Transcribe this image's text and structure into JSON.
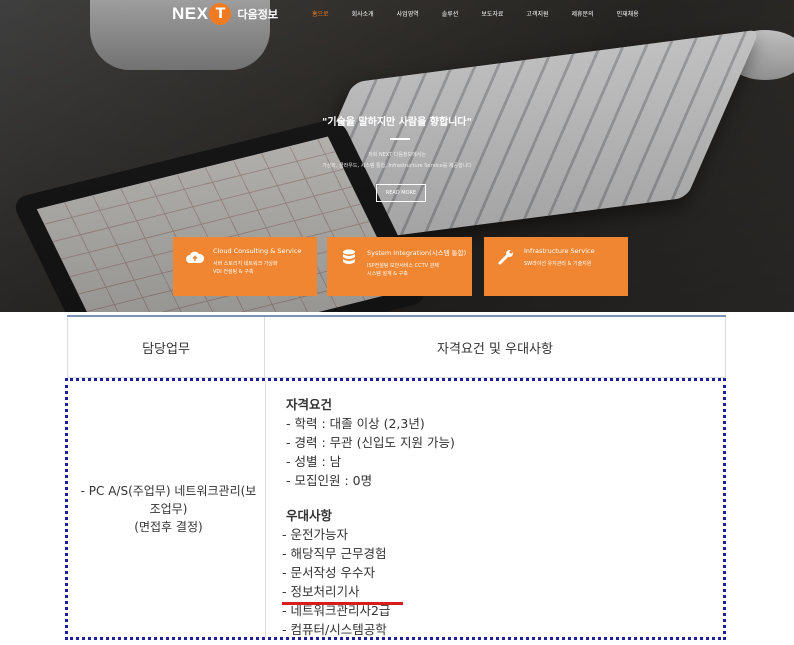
{
  "nav": {
    "logo_en": "NEX",
    "logo_circle": "T",
    "logo_ko": "다음정보",
    "menu": [
      "홈으로",
      "회사소개",
      "사업영역",
      "솔루션",
      "보도자료",
      "고객지원",
      "제휴문의",
      "인재채용"
    ]
  },
  "hero": {
    "tagline": "\"기술을 말하지만 사람을 향합니다\"",
    "sub1": "저희 NEXT 다음정보에서는",
    "sub2": "가상화, 클라우드, 시스템 통합, Infrastructure Service를 제공합니다",
    "read_more": "READ MORE",
    "cards": [
      {
        "title": "Cloud Consulting & Service",
        "line1": "서버 스토리지 네트워크 가상화",
        "line2": "VDI 컨설팅 & 구축",
        "icon": "cloud-upload-icon"
      },
      {
        "title": "System Integration(시스템 통합)",
        "line1": "ISP컨설팅 보안서비스 CCTV 관제",
        "line2": "시스템 설계 & 구축",
        "icon": "database-icon"
      },
      {
        "title": "Infrastructure Service",
        "line1": "SW라이선 유지관리 & 기술지원",
        "line2": "",
        "icon": "wrench-icon"
      }
    ],
    "accent": "#f07a22"
  },
  "table": {
    "col1_header": "담당업무",
    "col2_header": "자격요건 및 우대사항",
    "duty_line1": "- PC A/S(주업무) 네트워크관리(보",
    "duty_line2": "조업무)",
    "duty_line3": "(면접후 결정)",
    "qual_title": "자격요건",
    "qualifications": [
      "- 학력 : 대졸 이상 (2,3년)",
      "- 경력 : 무관 (신입도 지원 가능)",
      "- 성별 : 남",
      "- 모집인원 : 0명"
    ],
    "pref_title": "우대사항",
    "preferences": [
      "- 운전가능자",
      "- 해당직무 근무경험",
      "- 문서작성 우수자",
      "- 정보처리기사",
      "- 네트워크관리사2급",
      "- 컴퓨터/시스템공학"
    ]
  }
}
